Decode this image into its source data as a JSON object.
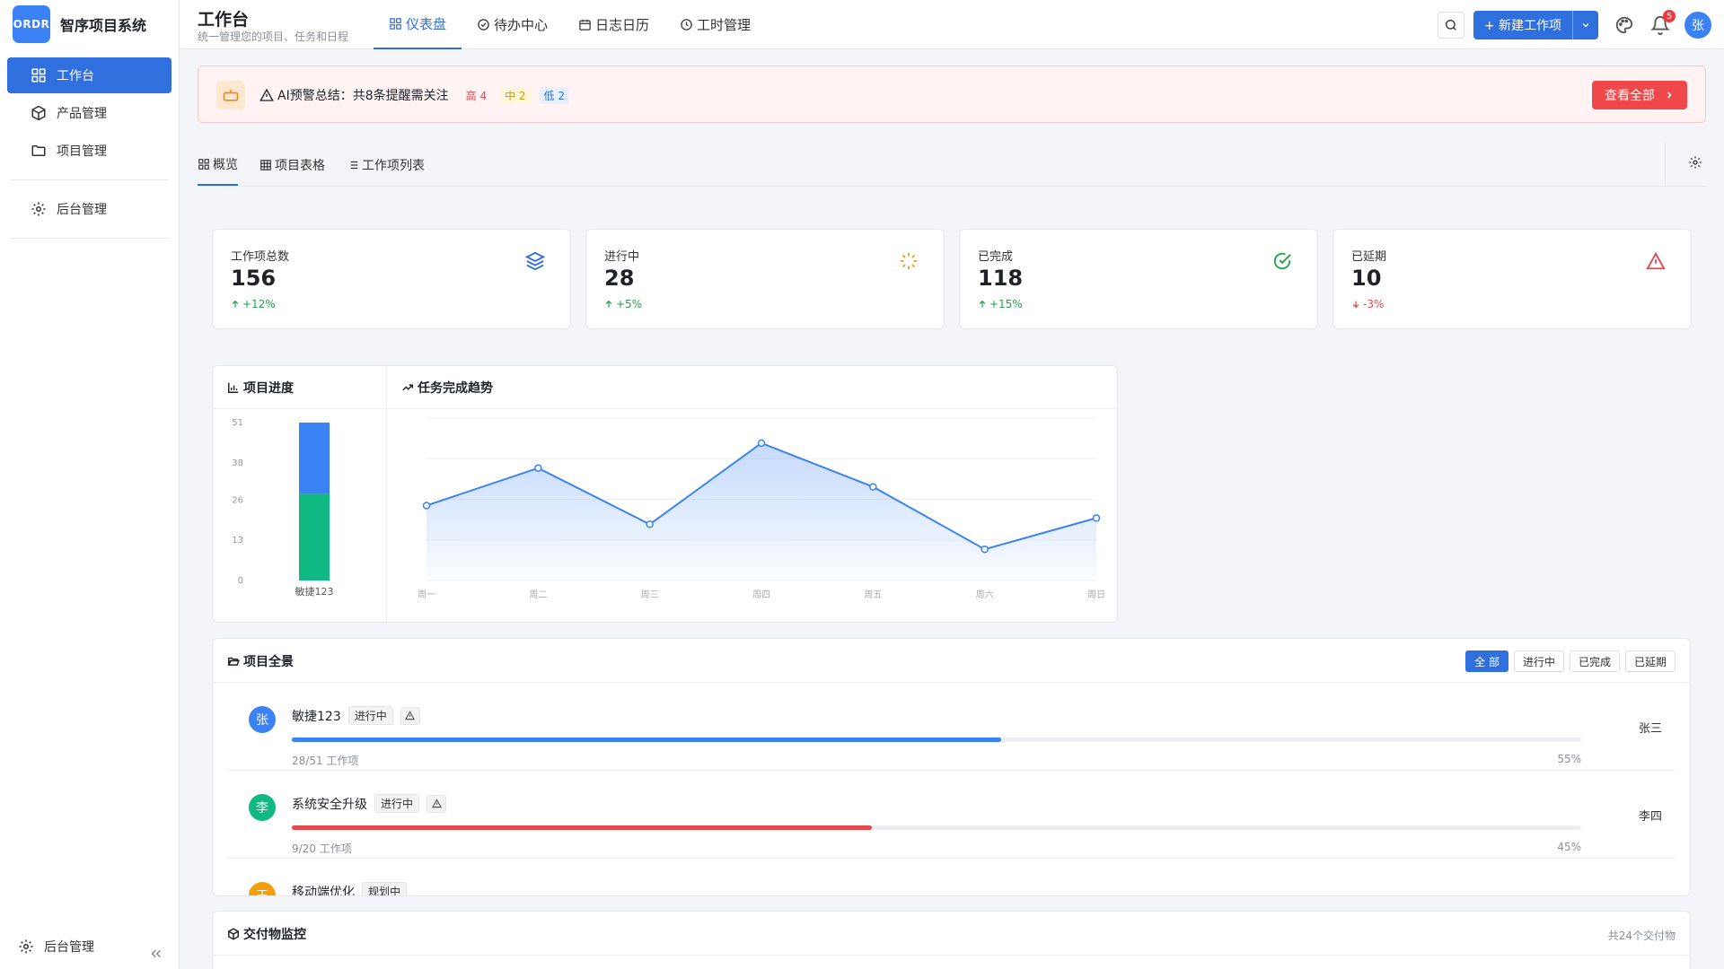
{
  "brand": {
    "logo_text": "ORDR",
    "name": "智序项目系统",
    "color": "#3b82f6"
  },
  "sidebar": {
    "items": [
      {
        "label": "工作台",
        "icon": "grid-icon",
        "active": true
      },
      {
        "label": "产品管理",
        "icon": "cube-icon"
      },
      {
        "label": "项目管理",
        "icon": "folder-icon"
      }
    ],
    "admin_label": "后台管理",
    "bottom_label": "后台管理"
  },
  "header": {
    "title": "工作台",
    "subtitle": "统一管理您的项目、任务和日程",
    "tabs": [
      {
        "label": "仪表盘",
        "icon": "grid-icon",
        "active": true
      },
      {
        "label": "待办中心",
        "icon": "check-circle-icon"
      },
      {
        "label": "日志日历",
        "icon": "calendar-icon"
      },
      {
        "label": "工时管理",
        "icon": "clock-icon"
      }
    ],
    "new_button_label": "+ 新建工作项",
    "notification_count": "5",
    "user_initial": "张"
  },
  "alert": {
    "text": "AI预警总结：共8条提醒需关注",
    "high": "高 4",
    "medium": "中 2",
    "low": "低 2",
    "button_label": "查看全部"
  },
  "sub_tabs": [
    {
      "label": "概览",
      "icon": "grid-icon",
      "active": true
    },
    {
      "label": "项目表格",
      "icon": "table-icon"
    },
    {
      "label": "工作项列表",
      "icon": "list-icon"
    }
  ],
  "stats": [
    {
      "label": "工作项总数",
      "value": "156",
      "change": "+12%",
      "direction": "up",
      "icon": "layers-icon",
      "color": "#2f6fde"
    },
    {
      "label": "进行中",
      "value": "28",
      "change": "+5%",
      "direction": "up",
      "icon": "loader-icon",
      "color": "#f0a020"
    },
    {
      "label": "已完成",
      "value": "118",
      "change": "+15%",
      "direction": "up",
      "icon": "check-circle-icon",
      "color": "#22a34b"
    },
    {
      "label": "已延期",
      "value": "10",
      "change": "-3%",
      "direction": "down",
      "icon": "alert-triangle-icon",
      "color": "#e5484d"
    }
  ],
  "charts": {
    "bar_title": "项目进度",
    "line_title": "任务完成趋势"
  },
  "chart_data": [
    {
      "type": "bar",
      "stacked": true,
      "categories": [
        "敏捷123"
      ],
      "series": [
        {
          "values": [
            28
          ],
          "color": "#10b981"
        },
        {
          "values": [
            23
          ],
          "color": "#3b82f6"
        }
      ],
      "yticks": [
        "0",
        "13",
        "26",
        "38",
        "51"
      ],
      "ylim": [
        0,
        51
      ]
    },
    {
      "type": "area",
      "categories": [
        "周一",
        "周二",
        "周三",
        "周四",
        "周五",
        "周六",
        "周日"
      ],
      "values": [
        12,
        18,
        9,
        22,
        15,
        5,
        10
      ],
      "ylim": [
        0,
        26
      ],
      "color": "#3b82f6",
      "grid": true
    }
  ],
  "overview": {
    "title": "项目全景",
    "filters": [
      {
        "label": "全 部",
        "active": true
      },
      {
        "label": "进行中"
      },
      {
        "label": "已完成"
      },
      {
        "label": "已延期"
      }
    ],
    "projects": [
      {
        "initial": "张",
        "avatar_color": "#3b82f6",
        "name": "敏捷123",
        "status": "进行中",
        "progress": 55,
        "progress_label": "55%",
        "count": "28/51 工作项",
        "owner": "张三",
        "bar_color": "#3b82f6"
      },
      {
        "initial": "李",
        "avatar_color": "#10b981",
        "name": "系统安全升级",
        "status": "进行中",
        "progress": 45,
        "progress_label": "45%",
        "count": "9/20 工作项",
        "owner": "李四",
        "bar_color": "#e5484d"
      },
      {
        "initial": "王",
        "avatar_color": "#f59e0b",
        "name": "移动端优化",
        "status": "规划中"
      }
    ]
  },
  "deliverables": {
    "title": "交付物监控",
    "count": "共24个交付物"
  }
}
